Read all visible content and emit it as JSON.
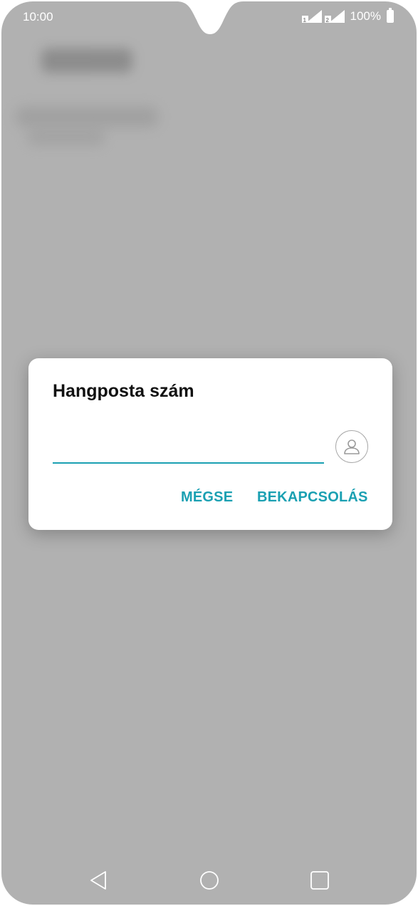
{
  "status_bar": {
    "time": "10:00",
    "battery_percent": "100%",
    "sim1_icon": "signal-sim1-icon",
    "sim2_icon": "signal-sim2-icon",
    "battery_icon": "battery-icon"
  },
  "dialog": {
    "title": "Hangposta szám",
    "input_value": "",
    "contact_icon": "contact-person-icon",
    "cancel_label": "MÉGSE",
    "confirm_label": "BEKAPCSOLÁS"
  },
  "navigation": {
    "back_icon": "back-triangle-icon",
    "home_icon": "home-circle-icon",
    "recents_icon": "recents-square-icon"
  },
  "colors": {
    "accent": "#1aa0b2",
    "scrim": "#b1b1b1",
    "dialog_bg": "#ffffff"
  }
}
